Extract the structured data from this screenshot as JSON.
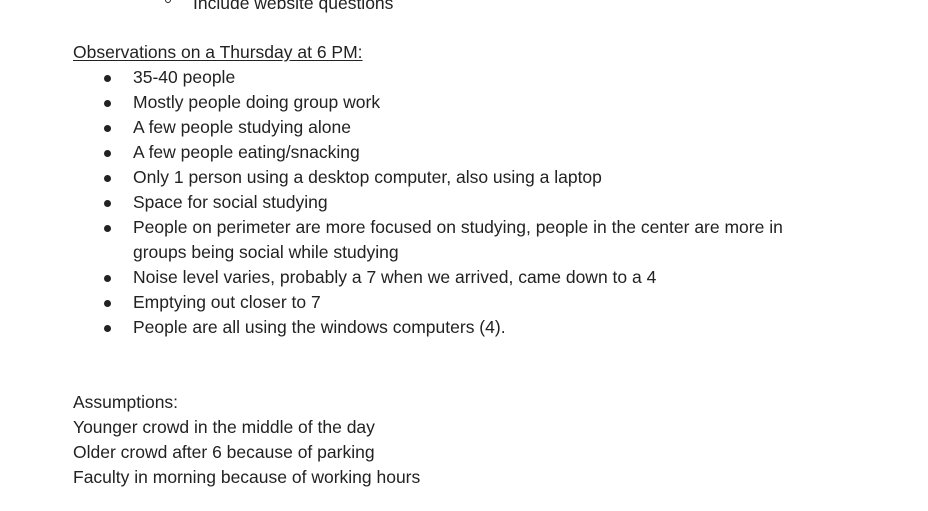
{
  "top_sub_item": "Include website questions",
  "observations": {
    "heading": "Observations on a Thursday at 6 PM:",
    "items": [
      "35-40 people",
      "Mostly people doing group work",
      "A few people studying alone",
      "A few people eating/snacking",
      "Only 1 person using a desktop computer, also using a laptop",
      "Space for social studying",
      "People on perimeter are more focused on studying, people in the center are more in groups being social while studying",
      "Noise level varies, probably a 7 when we arrived, came down to a 4",
      "Emptying out closer to 7",
      "People are all using the windows computers (4)."
    ]
  },
  "assumptions": {
    "heading": "Assumptions:",
    "lines": [
      "Younger crowd in the middle of the day",
      "Older crowd after 6 because of parking",
      "Faculty in morning because of working hours"
    ]
  }
}
